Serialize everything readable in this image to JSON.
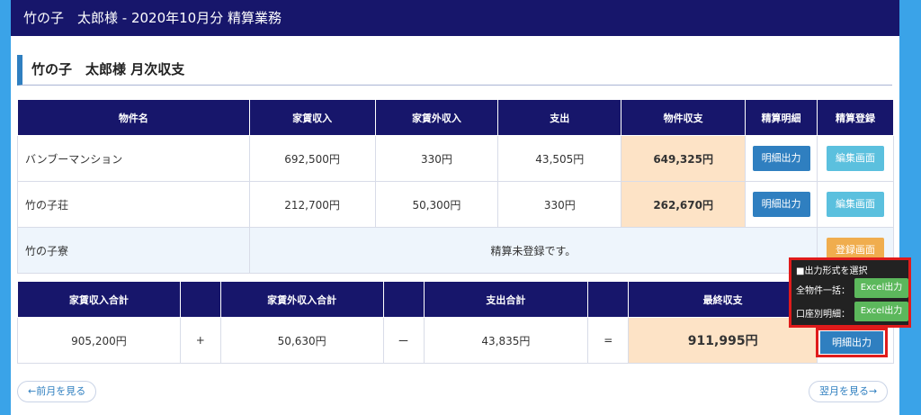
{
  "header": {
    "title": "竹の子　太郎様 - 2020年10月分 精算業務"
  },
  "section": {
    "title": "竹の子　太郎様 月次収支"
  },
  "property_table": {
    "headers": [
      "物件名",
      "家賃収入",
      "家賃外収入",
      "支出",
      "物件収支",
      "精算明細",
      "精算登録"
    ],
    "rows": [
      {
        "name": "バンブーマンション",
        "rent": "692,500円",
        "other": "330円",
        "expense": "43,505円",
        "balance": "649,325円",
        "detail_btn": "明細出力",
        "reg_btn": "編集画面"
      },
      {
        "name": "竹の子荘",
        "rent": "212,700円",
        "other": "50,300円",
        "expense": "330円",
        "balance": "262,670円",
        "detail_btn": "明細出力",
        "reg_btn": "編集画面"
      }
    ],
    "unregistered": {
      "name": "竹の子寮",
      "message": "精算未登録です。",
      "reg_btn": "登録画面"
    }
  },
  "summary_table": {
    "headers": [
      "家賃収入合計",
      "家賃外収入合計",
      "支出合計",
      "最終収支"
    ],
    "rent_total": "905,200円",
    "plus": "+",
    "other_total": "50,630円",
    "minus": "ー",
    "expense_total": "43,835円",
    "equals": "=",
    "final": "911,995円",
    "detail_btn": "明細出力"
  },
  "popup": {
    "title": "■出力形式を選択",
    "row1_label": "全物件一括：",
    "row2_label": "口座別明細：",
    "excel_label": "Excel出力"
  },
  "nav": {
    "prev": "←前月を見る",
    "next": "翌月を見る→"
  },
  "colors": {
    "navy": "#17166b",
    "blue": "#2f7fc0",
    "peach": "#fde3c6",
    "green": "#5cb85c",
    "highlight": "#e01b1b"
  }
}
